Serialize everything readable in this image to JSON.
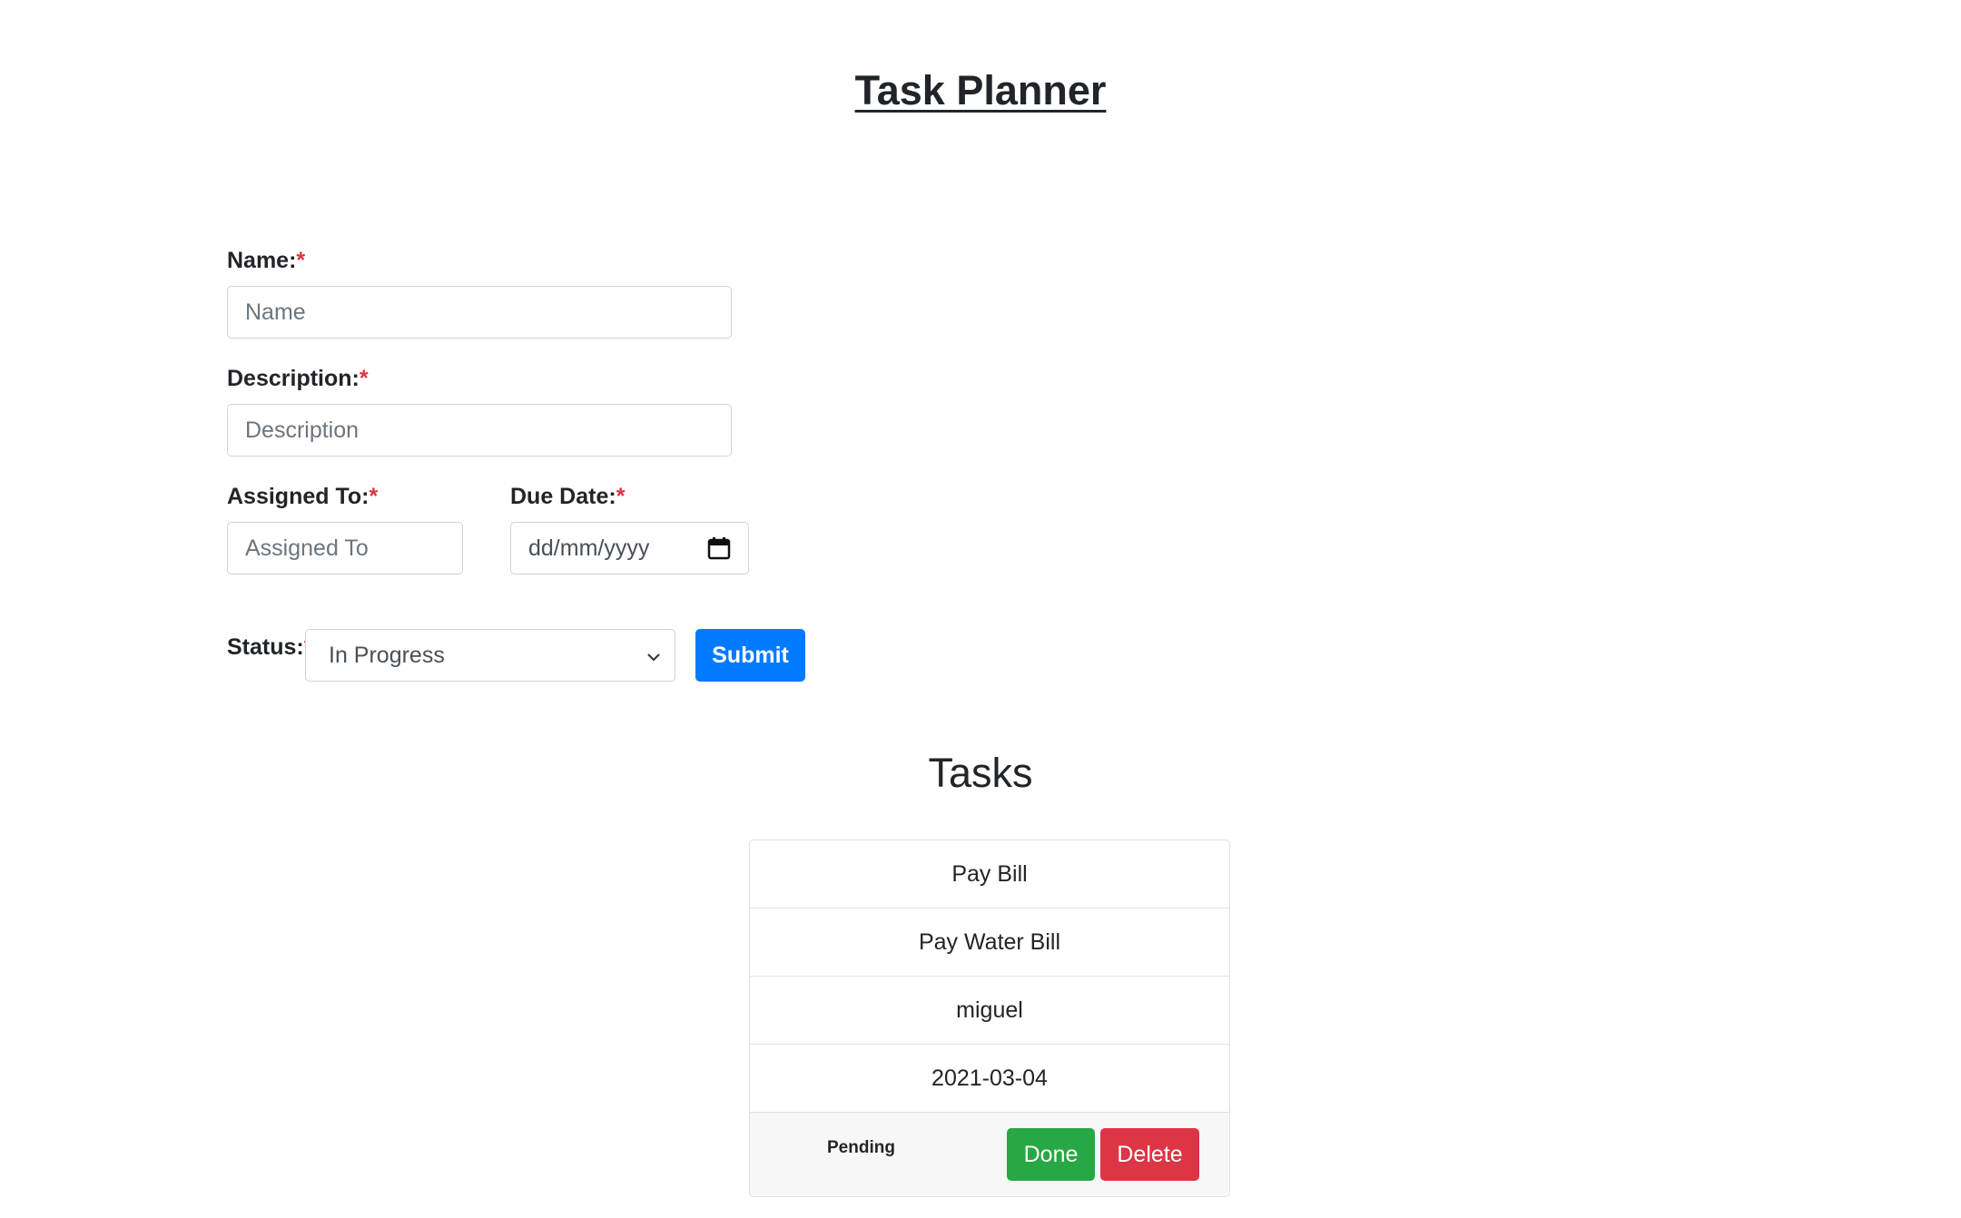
{
  "header": {
    "title": "Task Planner"
  },
  "form": {
    "name": {
      "label": "Name:",
      "required_mark": "*",
      "placeholder": "Name",
      "value": ""
    },
    "description": {
      "label": "Description:",
      "required_mark": "*",
      "placeholder": "Description",
      "value": ""
    },
    "assigned_to": {
      "label": "Assigned To:",
      "required_mark": "*",
      "placeholder": "Assigned To",
      "value": ""
    },
    "due_date": {
      "label": "Due Date:",
      "required_mark": "*",
      "placeholder": "dd/mm/yyyy"
    },
    "status": {
      "label": "Status:",
      "required_mark": "*",
      "selected": "In Progress"
    },
    "submit_label": "Submit"
  },
  "tasks_section": {
    "title": "Tasks",
    "tasks": [
      {
        "name": "Pay Bill",
        "description": "Pay Water Bill",
        "assigned_to": "miguel",
        "due_date": "2021-03-04",
        "status": "Pending",
        "done_label": "Done",
        "delete_label": "Delete"
      }
    ]
  },
  "colors": {
    "primary": "#007bff",
    "success": "#28a745",
    "danger": "#dc3545",
    "required": "#dc3545",
    "text": "#212529"
  },
  "icons": {
    "calendar": "calendar-icon",
    "select_arrow": "chevron-down-icon"
  }
}
